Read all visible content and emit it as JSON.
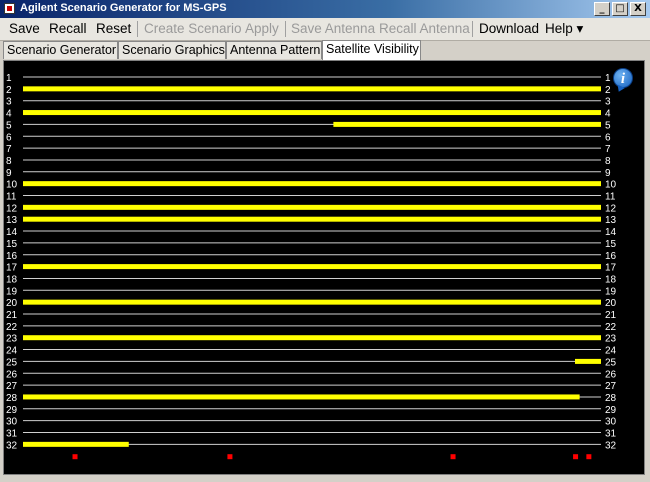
{
  "window": {
    "title": "Agilent Scenario Generator for MS-GPS",
    "buttons": [
      "_",
      "□",
      "X"
    ]
  },
  "menu": [
    {
      "label": "Save",
      "enabled": true
    },
    {
      "label": "Recall",
      "enabled": true
    },
    {
      "label": "Reset",
      "enabled": true
    },
    {
      "label": "Create Scenario",
      "enabled": false
    },
    {
      "label": "Apply",
      "enabled": false
    },
    {
      "label": "Save Antenna",
      "enabled": false
    },
    {
      "label": "Recall Antenna",
      "enabled": false
    },
    {
      "label": "Download",
      "enabled": true
    },
    {
      "label": "Help ▾",
      "enabled": true
    }
  ],
  "tabs": [
    {
      "label": "Scenario Generator",
      "active": false
    },
    {
      "label": "Scenario Graphics",
      "active": false
    },
    {
      "label": "Antenna Pattern",
      "active": false
    },
    {
      "label": "Satellite Visibility",
      "active": true
    }
  ],
  "chart_data": {
    "type": "gantt",
    "satellites": [
      "1",
      "2",
      "3",
      "4",
      "5",
      "6",
      "7",
      "8",
      "9",
      "10",
      "11",
      "12",
      "13",
      "14",
      "15",
      "16",
      "17",
      "18",
      "19",
      "20",
      "21",
      "22",
      "23",
      "24",
      "25",
      "26",
      "27",
      "28",
      "29",
      "30",
      "31",
      "32"
    ],
    "visibility": [
      {
        "sat": 2,
        "start": 0,
        "end": 1
      },
      {
        "sat": 4,
        "start": 0,
        "end": 1
      },
      {
        "sat": 5,
        "start": 0.537,
        "end": 1
      },
      {
        "sat": 10,
        "start": 0,
        "end": 1
      },
      {
        "sat": 12,
        "start": 0,
        "end": 1
      },
      {
        "sat": 13,
        "start": 0,
        "end": 1
      },
      {
        "sat": 17,
        "start": 0,
        "end": 1
      },
      {
        "sat": 20,
        "start": 0,
        "end": 1
      },
      {
        "sat": 23,
        "start": 0,
        "end": 1
      },
      {
        "sat": 25,
        "start": 0.955,
        "end": 1
      },
      {
        "sat": 28,
        "start": 0,
        "end": 0.963
      },
      {
        "sat": 32,
        "start": 0,
        "end": 0.183
      }
    ],
    "event_markers": [
      0.09,
      0.358,
      0.744,
      0.956,
      0.979
    ],
    "colors": {
      "background": "#000000",
      "grid": "#d0d0d0",
      "bar": "#ffff00",
      "marker": "#ff0000",
      "labels": "#ffffff"
    }
  },
  "info_icon": "i"
}
